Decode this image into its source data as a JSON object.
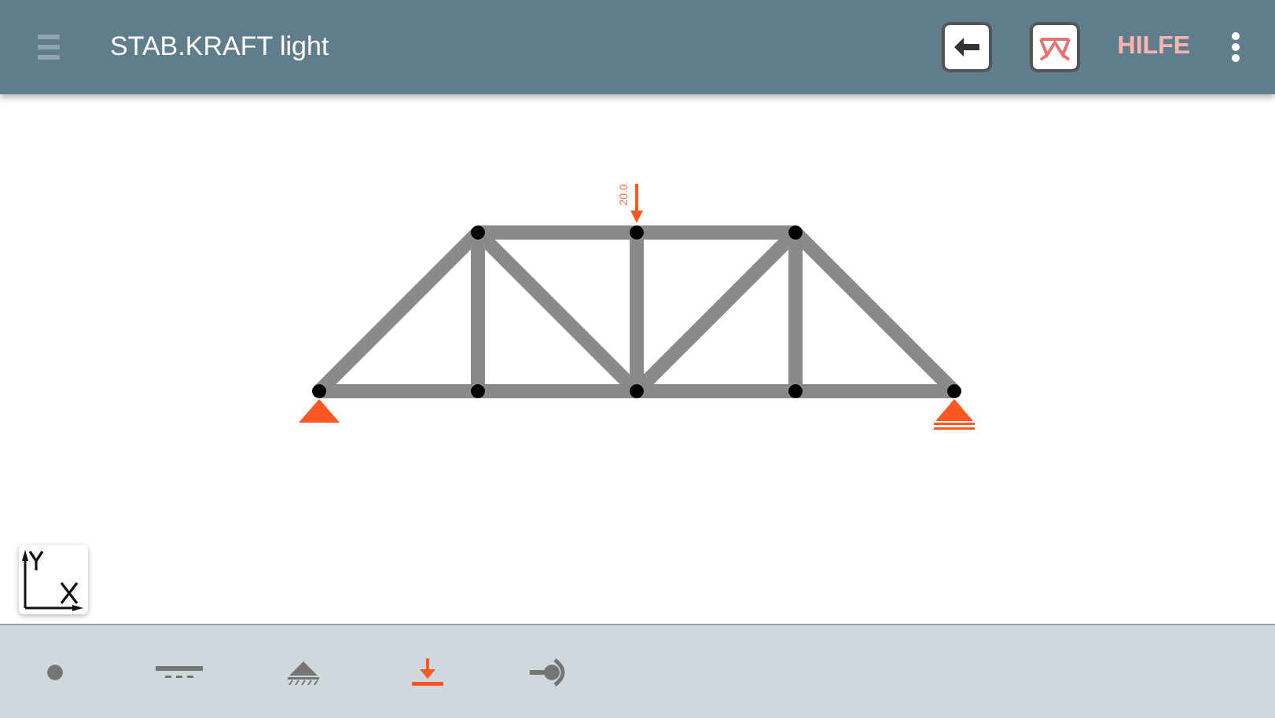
{
  "app_bar": {
    "title": "STAB.KRAFT light",
    "help_label": "HILFE"
  },
  "truss": {
    "supports": [
      {
        "kind": "pin"
      },
      {
        "kind": "roller"
      }
    ],
    "loads": [
      {
        "label": "20.0"
      }
    ]
  },
  "tools": [
    {
      "kind": "node",
      "selected": false
    },
    {
      "kind": "member",
      "selected": false
    },
    {
      "kind": "support",
      "selected": false
    },
    {
      "kind": "load",
      "selected": true
    },
    {
      "kind": "hinge",
      "selected": false
    }
  ]
}
